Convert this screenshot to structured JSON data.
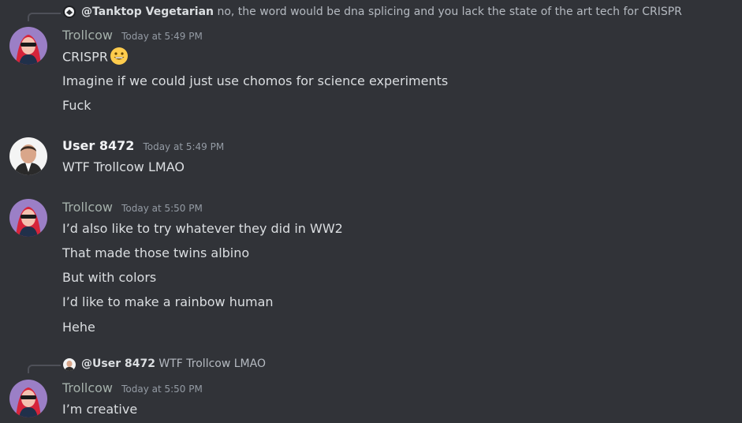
{
  "messages": [
    {
      "reply": {
        "author": "@Tanktop Vegetarian",
        "text": "no, the word would be dna splicing and you lack the state of the art tech for CRISPR"
      },
      "author": "Trollcow",
      "timestamp": "Today at 5:49 PM",
      "lines": [
        "CRISPR",
        "Imagine if we could just use chomos for science experiments",
        "Fuck"
      ]
    },
    {
      "author": "User 8472",
      "timestamp": "Today at 5:49 PM",
      "lines": [
        "WTF Trollcow LMAO"
      ]
    },
    {
      "author": "Trollcow",
      "timestamp": "Today at 5:50 PM",
      "lines": [
        "I’d also like to try whatever they did in WW2",
        "That made those twins albino",
        "But with colors",
        "I’d like to make a rainbow human",
        "Hehe"
      ]
    },
    {
      "reply": {
        "author": "@User 8472",
        "text": "WTF Trollcow LMAO"
      },
      "author": "Trollcow",
      "timestamp": "Today at 5:50 PM",
      "lines": [
        "I’m creative"
      ]
    }
  ],
  "icons": {
    "grinning": "grinning-face-emoji",
    "trollcow_avatar": "trollcow-avatar",
    "user_avatar": "user-8472-avatar",
    "tanktop_avatar": "tanktop-vegetarian-avatar"
  },
  "colors": {
    "background": "#313338",
    "trollcow_name": "#a4b0aa",
    "text": "#dbdee1",
    "muted": "#949ba4"
  }
}
